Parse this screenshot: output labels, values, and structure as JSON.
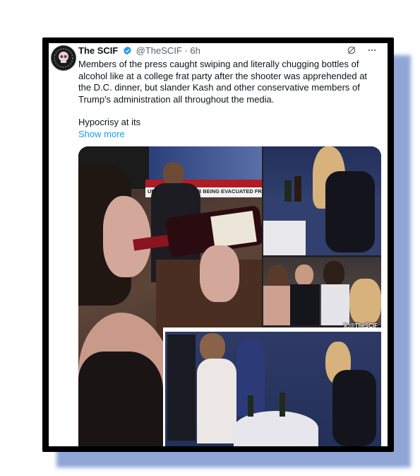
{
  "tweet": {
    "display_name": "The SCIF",
    "handle": "@TheSCIF",
    "separator": "·",
    "time": "6h",
    "body": "Members of the press caught swiping and literally chugging bottles of alcohol like at a college frat party after the shooter was apprehended at the D.C. dinner, but slander Kash and other conservative members of Trump's administration all throughout the media.",
    "tagline": "Hypocrisy at its",
    "show_more": "Show more",
    "media_watermark": "X:@TheSCIF",
    "ticker_text": "UMP SPEAKS AFTER BEING EVACUATED FR"
  },
  "icons": {
    "verified": "verified-badge-icon",
    "grok": "grok-icon",
    "more": "more-options-icon"
  },
  "colors": {
    "accent": "#1d9bf0",
    "text": "#0f1419",
    "muted": "#536471",
    "frame": "#000000",
    "shadow": "#8fa6d6"
  }
}
